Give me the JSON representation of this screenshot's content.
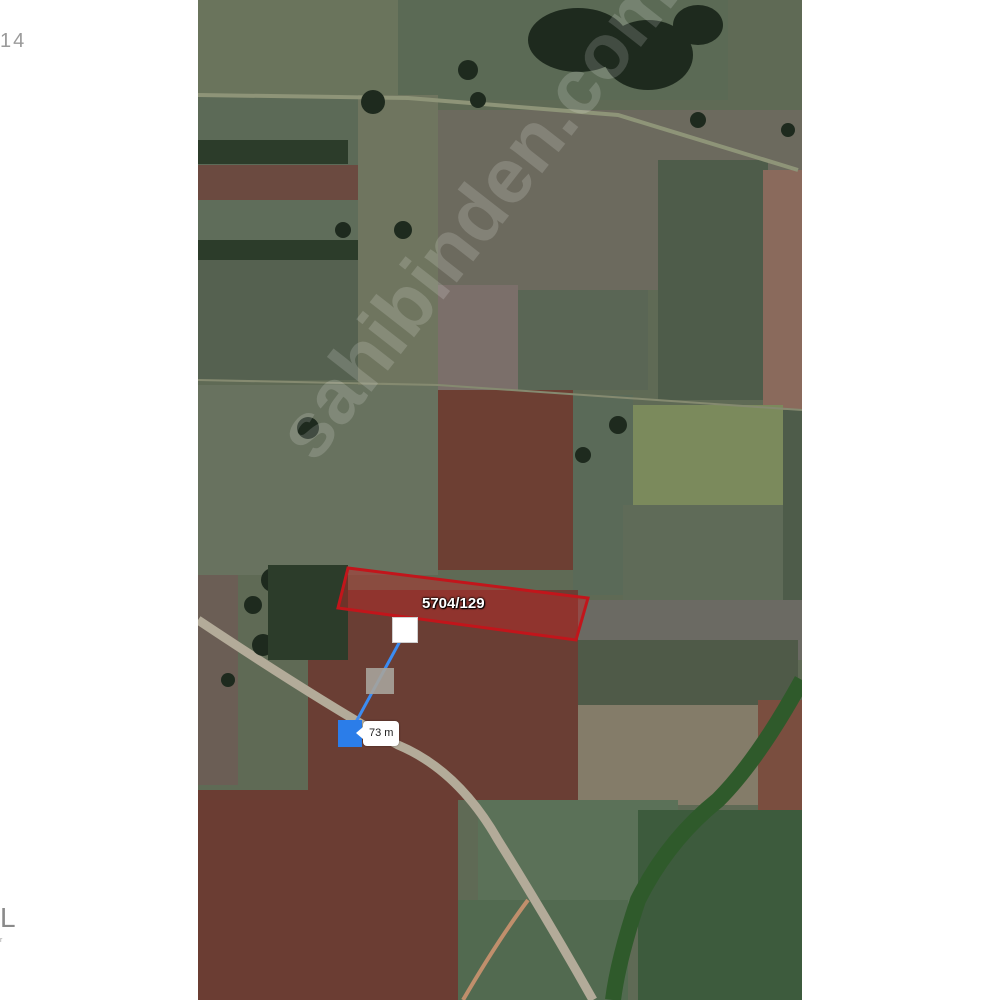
{
  "side": {
    "left_number": "14",
    "left_letter": "L",
    "left_small": "r"
  },
  "map": {
    "parcel_label": "5704/129",
    "distance_label": "73 m",
    "watermark": "sahibinden.com",
    "colors": {
      "parcel_outline": "#c2151b",
      "distance_line": "#3b8cf2",
      "marker_start": "#2b7de9"
    }
  }
}
